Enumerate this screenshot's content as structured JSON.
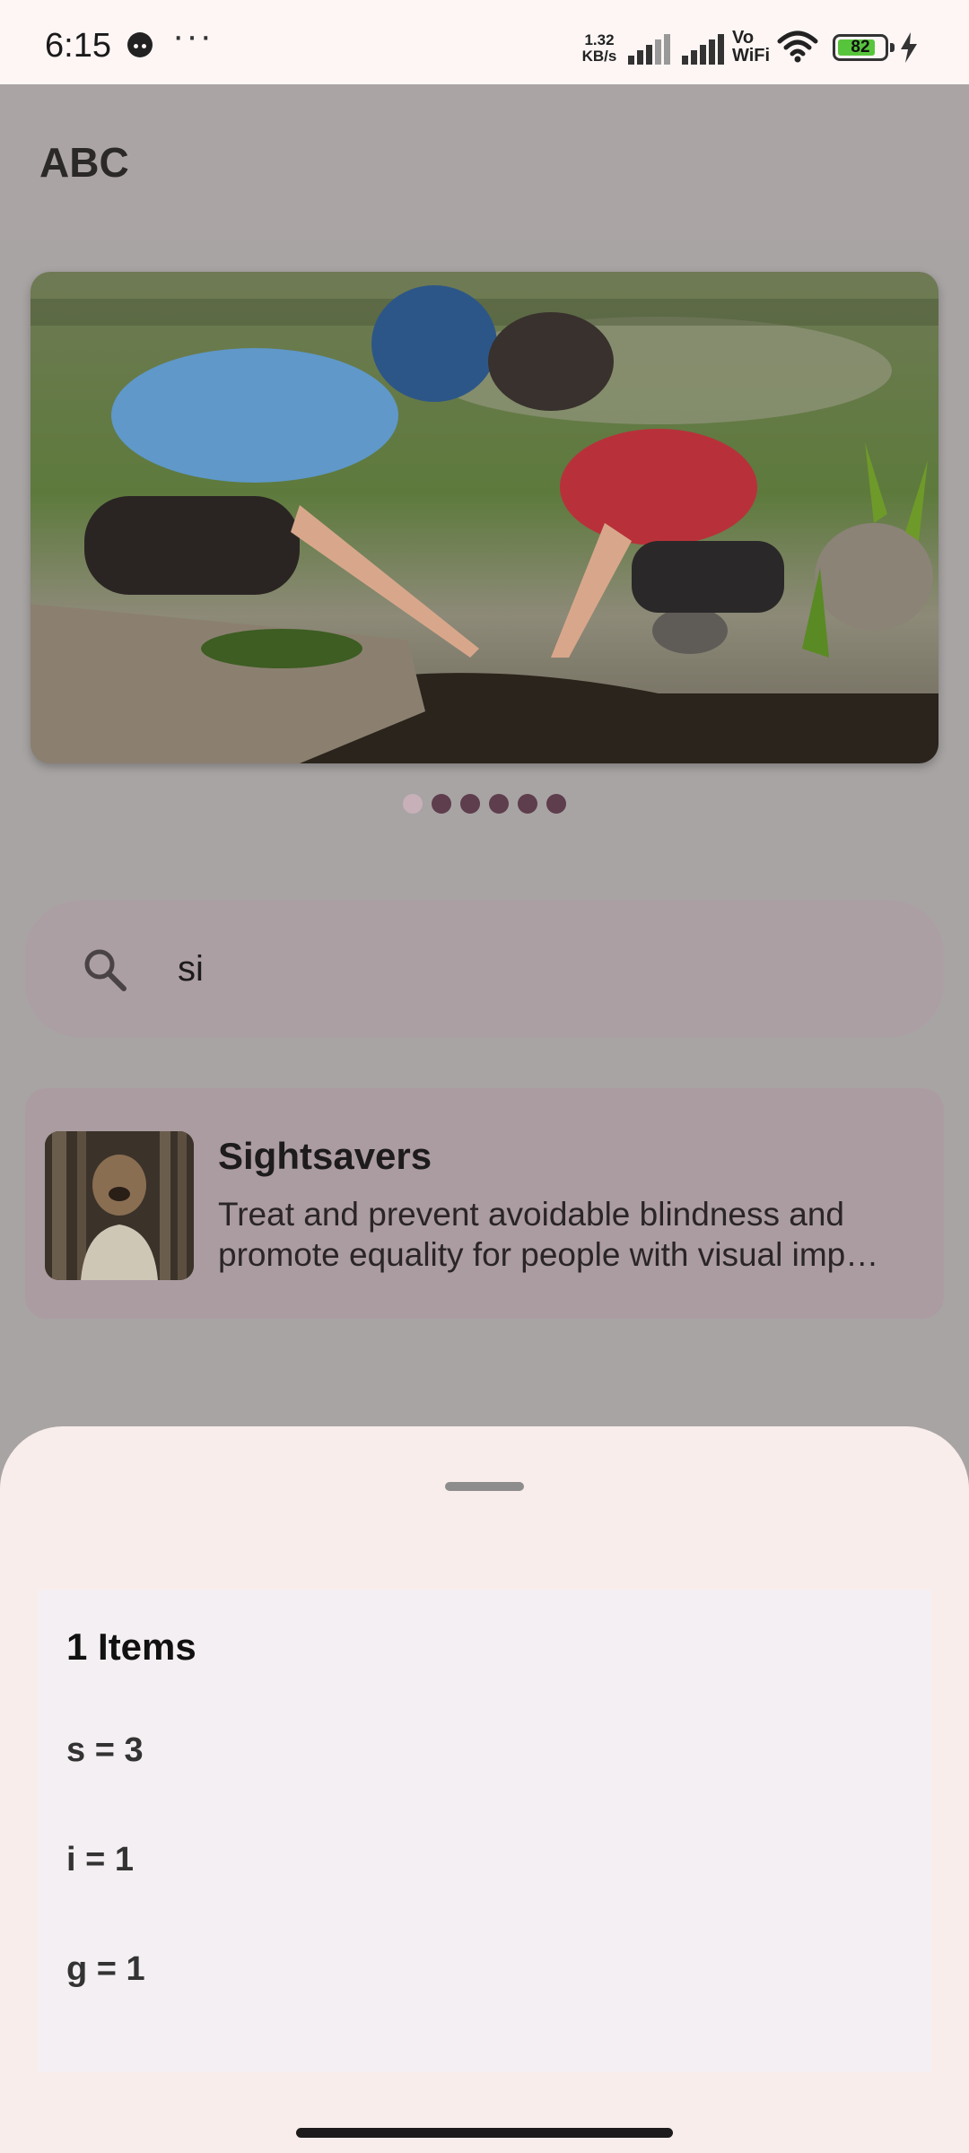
{
  "status_bar": {
    "time": "6:15",
    "more": "···",
    "net_speed_value": "1.32",
    "net_speed_unit": "KB/s",
    "vo": "Vo",
    "wifi_label": "WiFi",
    "battery_level": "82",
    "battery_fraction": 0.82,
    "battery_color": "#57c53c"
  },
  "app_bar": {
    "title": "ABC"
  },
  "carousel": {
    "slide_count": 6,
    "active_index": 0
  },
  "search": {
    "value": "si",
    "icon": "search-icon"
  },
  "results": [
    {
      "title": "Sightsavers",
      "description": "Treat and prevent avoidable blindness and promote equality for people with visual imp…"
    }
  ],
  "bottom_sheet": {
    "count_label": "1 Items",
    "items": [
      "s = 3",
      "i = 1",
      "g = 1"
    ]
  },
  "colors": {
    "accent": "#5e3d4c",
    "sheet_background": "#f8edeb",
    "scrim": "#a8a4a4"
  }
}
